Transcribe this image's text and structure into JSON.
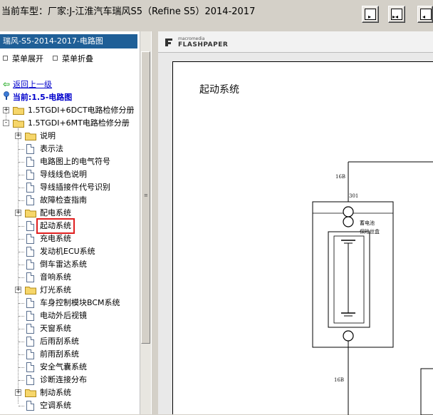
{
  "window": {
    "title": "当前车型：厂家:J-江淮汽车瑞风S5（Refine S5）2014-2017"
  },
  "toolbar": {
    "buttons": [
      {
        "name": "single-page-button",
        "icon": "single-page-icon"
      },
      {
        "name": "two-page-button",
        "icon": "two-page-icon"
      },
      {
        "name": "fit-width-button",
        "icon": "fit-width-icon"
      }
    ]
  },
  "sidebar": {
    "header": "瑞风-S5-2014-2017-电路图",
    "expand_all": "菜单展开",
    "collapse_all": "菜单折叠",
    "back": "返回上一级",
    "current": "当前:1.5-电路图",
    "tree": [
      {
        "label": "1.5TGDI+6DCT电路检修分册",
        "kind": "folder",
        "level": 0,
        "expander": "+"
      },
      {
        "label": "1.5TGDI+6MT电路检修分册",
        "kind": "folder",
        "level": 0,
        "expander": "-"
      },
      {
        "label": "说明",
        "kind": "folder",
        "level": 1,
        "expander": "+"
      },
      {
        "label": "表示法",
        "kind": "doc",
        "level": 1
      },
      {
        "label": "电路图上的电气符号",
        "kind": "doc",
        "level": 1
      },
      {
        "label": "导线线色说明",
        "kind": "doc",
        "level": 1
      },
      {
        "label": "导线插接件代号识别",
        "kind": "doc",
        "level": 1
      },
      {
        "label": "故障检查指南",
        "kind": "doc",
        "level": 1
      },
      {
        "label": "配电系统",
        "kind": "folder",
        "level": 1,
        "expander": "+"
      },
      {
        "label": "起动系统",
        "kind": "doc",
        "level": 1,
        "selected": true
      },
      {
        "label": "充电系统",
        "kind": "doc",
        "level": 1
      },
      {
        "label": "发动机ECU系统",
        "kind": "doc",
        "level": 1
      },
      {
        "label": "倒车雷达系统",
        "kind": "doc",
        "level": 1
      },
      {
        "label": "音响系统",
        "kind": "doc",
        "level": 1
      },
      {
        "label": "灯光系统",
        "kind": "folder",
        "level": 1,
        "expander": "+"
      },
      {
        "label": "车身控制模块BCM系统",
        "kind": "doc",
        "level": 1
      },
      {
        "label": "电动外后视镜",
        "kind": "doc",
        "level": 1
      },
      {
        "label": "天窗系统",
        "kind": "doc",
        "level": 1
      },
      {
        "label": "后雨刮系统",
        "kind": "doc",
        "level": 1
      },
      {
        "label": "前雨刮系统",
        "kind": "doc",
        "level": 1
      },
      {
        "label": "安全气囊系统",
        "kind": "doc",
        "level": 1
      },
      {
        "label": "诊断连接分布",
        "kind": "doc",
        "level": 1
      },
      {
        "label": "制动系统",
        "kind": "folder",
        "level": 1,
        "expander": "+"
      },
      {
        "label": "空调系统",
        "kind": "doc",
        "level": 1
      }
    ]
  },
  "viewer": {
    "brand_small": "macromedia",
    "brand_big": "FLASHPAPER",
    "page_title": "起动系统",
    "wire_top": "16B",
    "wire_bottom": "16B",
    "connector": "301",
    "component_line1": "蓄电池",
    "component_line2": "保险丝盒"
  },
  "colors": {
    "sidebar_header_bg": "#1f5f97",
    "highlight_box": "#e02020",
    "link": "#0000cc"
  }
}
